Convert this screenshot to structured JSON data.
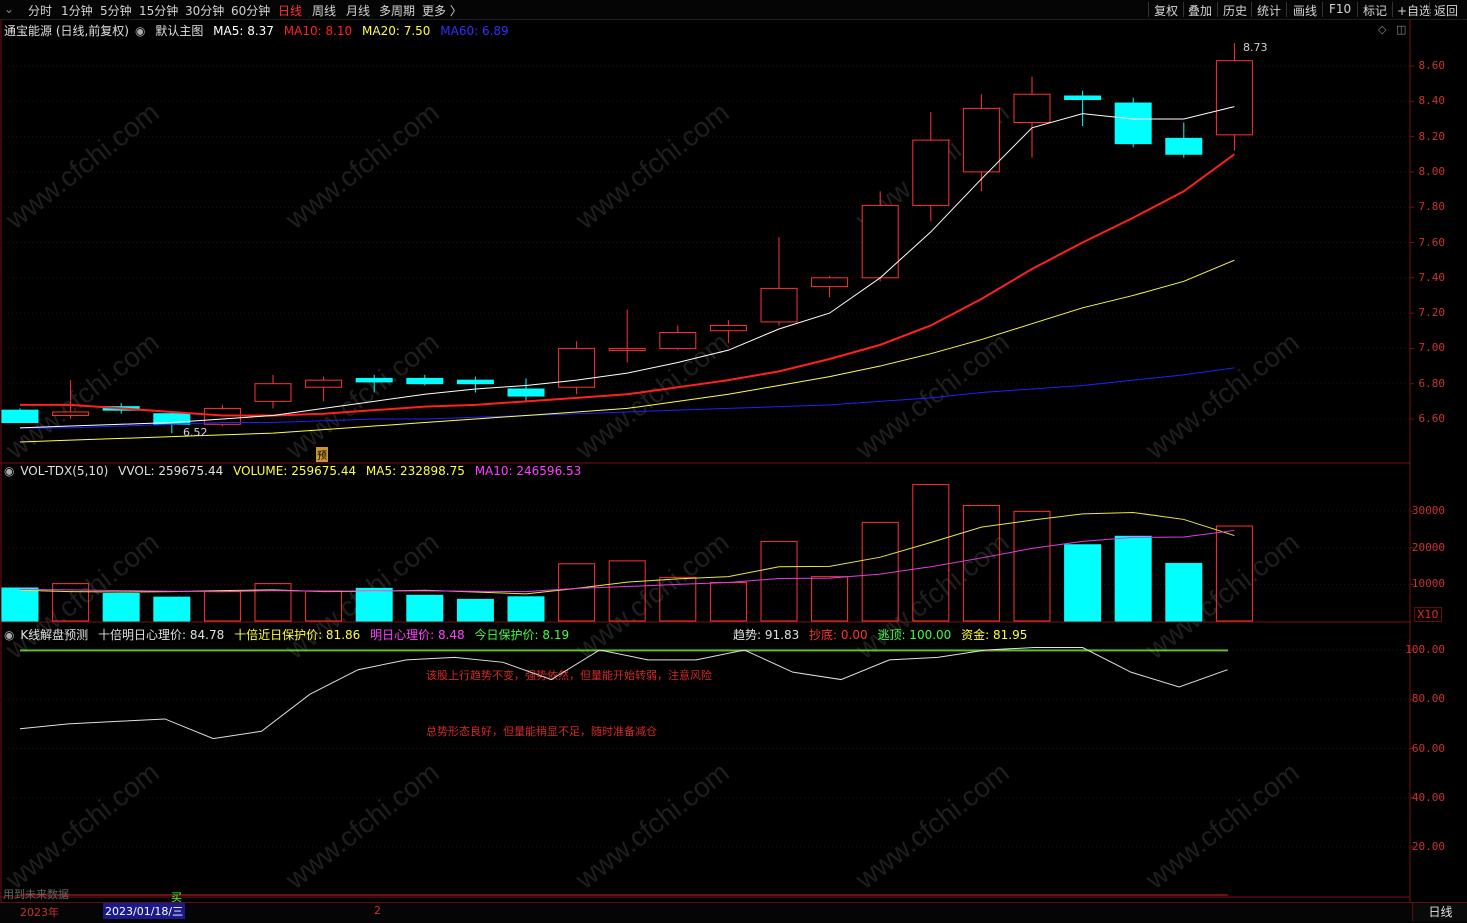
{
  "toolbar": {
    "left": [
      "分时",
      "1分钟",
      "5分钟",
      "15分钟",
      "30分钟",
      "60分钟",
      "日线",
      "周线",
      "月线",
      "多周期",
      "更多 〉"
    ],
    "active": "日线",
    "right": [
      "复权",
      "叠加",
      "历史",
      "统计",
      "画线",
      "F10",
      "标记",
      "+自选",
      "返回"
    ]
  },
  "main_header": {
    "stock": "通宝能源 (日线,前复权)",
    "template": "默认主图",
    "ma5": "MA5: 8.37",
    "ma10": "MA10: 8.10",
    "ma20": "MA20: 7.50",
    "ma60": "MA60: 6.89"
  },
  "vol_header": {
    "name": "VOL-TDX(5,10)",
    "vvol": "VVOL: 259675.44",
    "volume": "VOLUME: 259675.44",
    "ma5": "MA5: 232898.75",
    "ma10": "MA10: 246596.53"
  },
  "ind_header": {
    "name": "K线解盘预测",
    "a": "十倍明日心理价: 84.78",
    "b": "十倍近日保护价: 81.86",
    "c": "明日心理价: 8.48",
    "d": "今日保护价: 8.19",
    "trend": "趋势: 91.83",
    "bottom": "抄底: 0.00",
    "escape": "逃顶: 100.00",
    "fund": "资金: 81.95"
  },
  "notes": {
    "line1": "该股上行趋势不变，强势依然，但量能开始转弱，注意风险",
    "line2": "总势形态良好，但量能稍显不足，随时准备减仓"
  },
  "labels": {
    "high": "8.73",
    "low": "6.52",
    "yu": "预",
    "buy": "买",
    "future": "用到未来数据",
    "year": "2023年",
    "date": "2023/01/18/三",
    "month": "2",
    "period": "日线",
    "x10": "X10"
  },
  "colors": {
    "up": "#ff3232",
    "down": "#00ffff",
    "ma5": "#ffffff",
    "ma10": "#ff2020",
    "ma20": "#ffff40",
    "ma60": "#2020ff",
    "grid": "#7a1010"
  },
  "chart_data": {
    "type": "candlestick",
    "price_axis": [
      "8.60",
      "8.40",
      "8.20",
      "8.00",
      "7.80",
      "7.60",
      "7.40",
      "7.20",
      "7.00",
      "6.80",
      "6.60"
    ],
    "vol_axis": [
      "30000",
      "20000",
      "10000"
    ],
    "ind_axis": [
      "100.00",
      "80.00",
      "60.00",
      "40.00",
      "20.00"
    ],
    "ylim": [
      6.45,
      8.75
    ],
    "candles": [
      {
        "o": 6.65,
        "h": 6.66,
        "l": 6.58,
        "c": 6.58,
        "v": 9000
      },
      {
        "o": 6.62,
        "h": 6.82,
        "l": 6.6,
        "c": 6.64,
        "v": 10200
      },
      {
        "o": 6.67,
        "h": 6.69,
        "l": 6.63,
        "c": 6.65,
        "v": 7500
      },
      {
        "o": 6.63,
        "h": 6.64,
        "l": 6.52,
        "c": 6.57,
        "v": 6500
      },
      {
        "o": 6.57,
        "h": 6.68,
        "l": 6.56,
        "c": 6.66,
        "v": 8000
      },
      {
        "o": 6.7,
        "h": 6.85,
        "l": 6.66,
        "c": 6.8,
        "v": 10200
      },
      {
        "o": 6.78,
        "h": 6.84,
        "l": 6.7,
        "c": 6.82,
        "v": 8200
      },
      {
        "o": 6.83,
        "h": 6.85,
        "l": 6.75,
        "c": 6.81,
        "v": 8900
      },
      {
        "o": 6.83,
        "h": 6.85,
        "l": 6.79,
        "c": 6.8,
        "v": 7000
      },
      {
        "o": 6.82,
        "h": 6.84,
        "l": 6.75,
        "c": 6.8,
        "v": 5900
      },
      {
        "o": 6.77,
        "h": 6.83,
        "l": 6.7,
        "c": 6.73,
        "v": 6600
      },
      {
        "o": 6.78,
        "h": 7.04,
        "l": 6.74,
        "c": 7.0,
        "v": 15600
      },
      {
        "o": 6.99,
        "h": 7.22,
        "l": 6.92,
        "c": 7.0,
        "v": 16400
      },
      {
        "o": 7.0,
        "h": 7.13,
        "l": 6.99,
        "c": 7.09,
        "v": 11900
      },
      {
        "o": 7.1,
        "h": 7.16,
        "l": 7.03,
        "c": 7.13,
        "v": 10500
      },
      {
        "o": 7.15,
        "h": 7.63,
        "l": 7.13,
        "c": 7.34,
        "v": 21700
      },
      {
        "o": 7.35,
        "h": 7.41,
        "l": 7.29,
        "c": 7.4,
        "v": 12100
      },
      {
        "o": 7.4,
        "h": 7.89,
        "l": 7.38,
        "c": 7.81,
        "v": 26900
      },
      {
        "o": 7.81,
        "h": 8.34,
        "l": 7.72,
        "c": 8.18,
        "v": 37200
      },
      {
        "o": 8.0,
        "h": 8.44,
        "l": 7.89,
        "c": 8.36,
        "v": 31500
      },
      {
        "o": 8.28,
        "h": 8.54,
        "l": 8.08,
        "c": 8.44,
        "v": 29900
      },
      {
        "o": 8.43,
        "h": 8.46,
        "l": 8.26,
        "c": 8.41,
        "v": 20800
      },
      {
        "o": 8.39,
        "h": 8.42,
        "l": 8.14,
        "c": 8.16,
        "v": 23100
      },
      {
        "o": 8.19,
        "h": 8.28,
        "l": 8.08,
        "c": 8.1,
        "v": 15700
      },
      {
        "o": 8.21,
        "h": 8.73,
        "l": 8.12,
        "c": 8.63,
        "v": 25900
      }
    ],
    "ma5": [
      6.55,
      6.56,
      6.57,
      6.58,
      6.6,
      6.62,
      6.66,
      6.7,
      6.74,
      6.77,
      6.79,
      6.82,
      6.86,
      6.92,
      6.99,
      7.11,
      7.2,
      7.4,
      7.66,
      7.96,
      8.25,
      8.33,
      8.3,
      8.3,
      8.37
    ],
    "ma10": [
      6.68,
      6.68,
      6.66,
      6.64,
      6.62,
      6.62,
      6.63,
      6.65,
      6.67,
      6.68,
      6.7,
      6.72,
      6.74,
      6.78,
      6.82,
      6.87,
      6.94,
      7.02,
      7.13,
      7.28,
      7.45,
      7.6,
      7.74,
      7.89,
      8.1
    ],
    "ma20": [
      6.47,
      6.48,
      6.49,
      6.5,
      6.51,
      6.52,
      6.54,
      6.56,
      6.58,
      6.6,
      6.62,
      6.64,
      6.66,
      6.7,
      6.74,
      6.79,
      6.84,
      6.9,
      6.97,
      7.05,
      7.14,
      7.23,
      7.3,
      7.38,
      7.5
    ],
    "ma60": [
      6.55,
      6.55,
      6.56,
      6.57,
      6.58,
      6.58,
      6.59,
      6.6,
      6.6,
      6.61,
      6.62,
      6.63,
      6.64,
      6.65,
      6.66,
      6.67,
      6.68,
      6.7,
      6.72,
      6.75,
      6.77,
      6.79,
      6.82,
      6.85,
      6.89
    ],
    "vol_ma5": [
      8400,
      8000,
      7900,
      8000,
      8300,
      8500,
      8000,
      8100,
      8400,
      7900,
      7400,
      8900,
      10600,
      11500,
      12100,
      14800,
      14900,
      17400,
      21400,
      25600,
      27500,
      29200,
      29600,
      27700,
      23300
    ],
    "vol_ma10": [
      8600,
      8500,
      8300,
      8100,
      8000,
      8300,
      8100,
      8200,
      8200,
      8100,
      8000,
      8900,
      9400,
      10000,
      10500,
      11600,
      11700,
      12800,
      14800,
      17200,
      19800,
      21700,
      22800,
      22900,
      24700
    ],
    "trend": [
      68,
      70,
      71,
      72,
      64,
      67,
      82,
      92,
      96,
      97,
      95,
      88,
      100,
      96,
      96,
      100,
      91,
      88,
      96,
      97,
      100,
      101,
      101,
      91,
      85,
      92
    ]
  }
}
